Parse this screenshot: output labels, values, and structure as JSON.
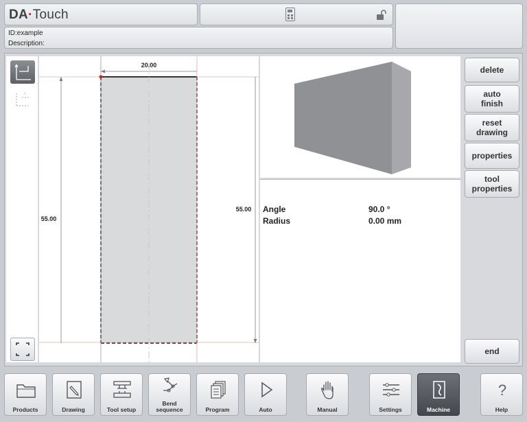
{
  "brand": {
    "logo_prefix": "DA",
    "logo_dot": "·",
    "logo_suffix": "Touch"
  },
  "info": {
    "id_line": "ID:example",
    "description_line": "Description:"
  },
  "drawing": {
    "dim_top": "20.00",
    "dim_left": "55.00",
    "dim_right": "55.00"
  },
  "properties": {
    "angle_label": "Angle",
    "angle_value": "90.0 °",
    "radius_label": "Radius",
    "radius_value": "0.00 mm"
  },
  "side_buttons": {
    "delete": "delete",
    "auto_1": "auto",
    "auto_2": "finish",
    "reset_1": "reset",
    "reset_2": "drawing",
    "properties": "properties",
    "tool_1": "tool",
    "tool_2": "properties",
    "end": "end"
  },
  "bottom_nav": {
    "products": "Products",
    "drawing": "Drawing",
    "tool_setup": "Tool setup",
    "bend_1": "Bend",
    "bend_2": "sequence",
    "program": "Program",
    "auto": "Auto",
    "manual": "Manual",
    "settings": "Settings",
    "machine": "Machine",
    "help": "Help"
  },
  "colors": {
    "accent_red": "#d9261c",
    "part_fill": "#d9dadc",
    "shape_front": "#8c8e91",
    "shape_side": "#a3a5a8",
    "active_button": "#55585d"
  }
}
